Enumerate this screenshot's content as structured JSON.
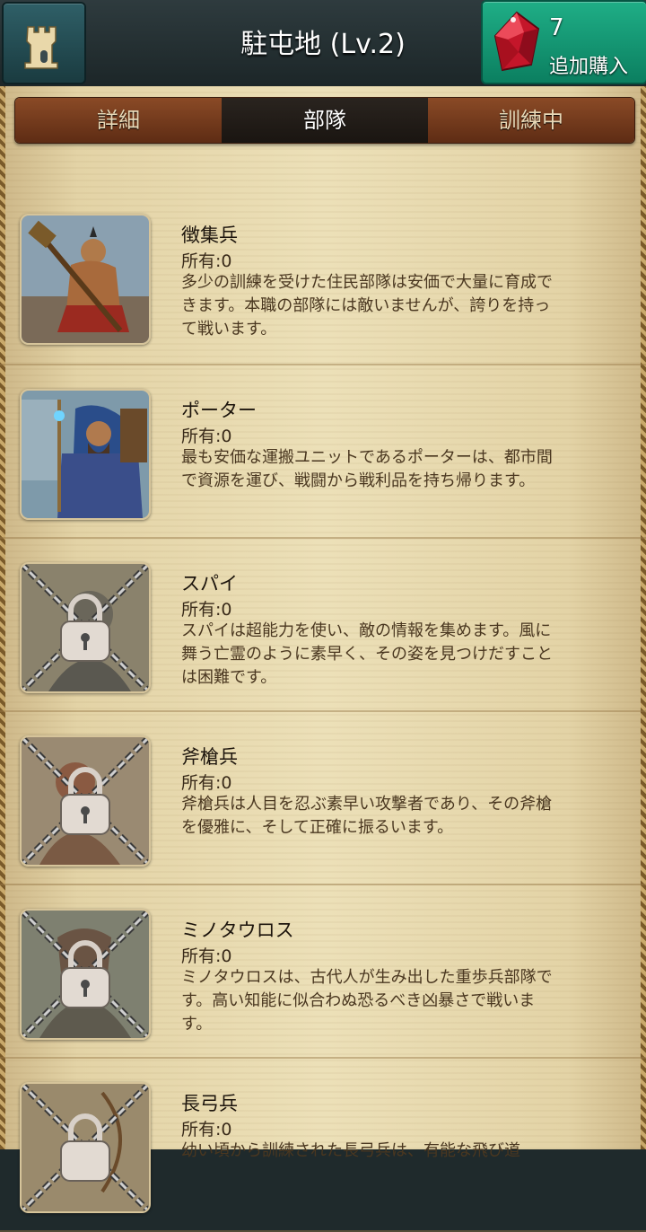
{
  "header": {
    "title": "駐屯地 (Lv.2)",
    "home_icon": "castle-tower-icon",
    "gem_count": "7",
    "buy_label": "追加購入",
    "gem_icon": "red-gem-icon"
  },
  "tabs": [
    {
      "label": "詳細",
      "active": false
    },
    {
      "label": "部隊",
      "active": true
    },
    {
      "label": "訓練中",
      "active": false
    }
  ],
  "troops": [
    {
      "name": "徴集兵",
      "owned": "所有:0",
      "locked": false,
      "desc": "多少の訓練を受けた住民部隊は安価で大量に育成できます。本職の部隊には敵いませんが、誇りを持って戦います。"
    },
    {
      "name": "ポーター",
      "owned": "所有:0",
      "locked": false,
      "desc": "最も安価な運搬ユニットであるポーターは、都市間で資源を運び、戦闘から戦利品を持ち帰ります。"
    },
    {
      "name": "スパイ",
      "owned": "所有:0",
      "locked": true,
      "desc": "スパイは超能力を使い、敵の情報を集めます。風に舞う亡霊のように素早く、その姿を見つけだすことは困難です。"
    },
    {
      "name": "斧槍兵",
      "owned": "所有:0",
      "locked": true,
      "desc": "斧槍兵は人目を忍ぶ素早い攻撃者であり、その斧槍を優雅に、そして正確に振るいます。"
    },
    {
      "name": "ミノタウロス",
      "owned": "所有:0",
      "locked": true,
      "desc": "ミノタウロスは、古代人が生み出した重歩兵部隊です。高い知能に似合わぬ恐るべき凶暴さで戦います。"
    },
    {
      "name": "長弓兵",
      "owned": "所有:0",
      "locked": true,
      "desc": "幼い頃から訓練された長弓兵は、有能な飛び道"
    }
  ],
  "colors": {
    "accent_green": "#0f9a75",
    "tab_brown": "#6b3519",
    "parchment": "#e8dab0"
  }
}
